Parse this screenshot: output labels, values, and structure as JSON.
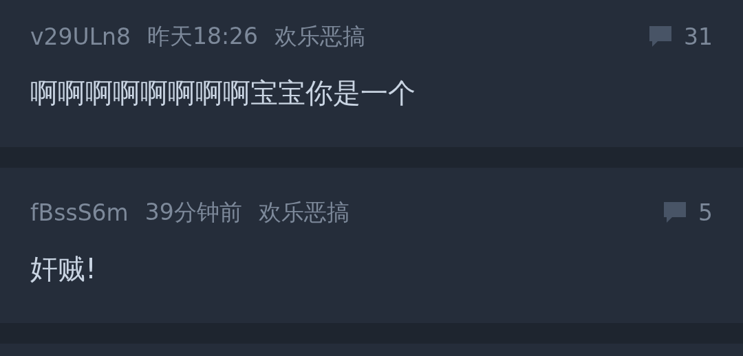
{
  "posts": [
    {
      "user": "v29ULn8",
      "time": "昨天18:26",
      "category": "欢乐恶搞",
      "comments": "31",
      "text": "啊啊啊啊啊啊啊啊宝宝你是一个"
    },
    {
      "user": "fBssS6m",
      "time": "39分钟前",
      "category": "欢乐恶搞",
      "comments": "5",
      "text": "奸贼!"
    }
  ]
}
